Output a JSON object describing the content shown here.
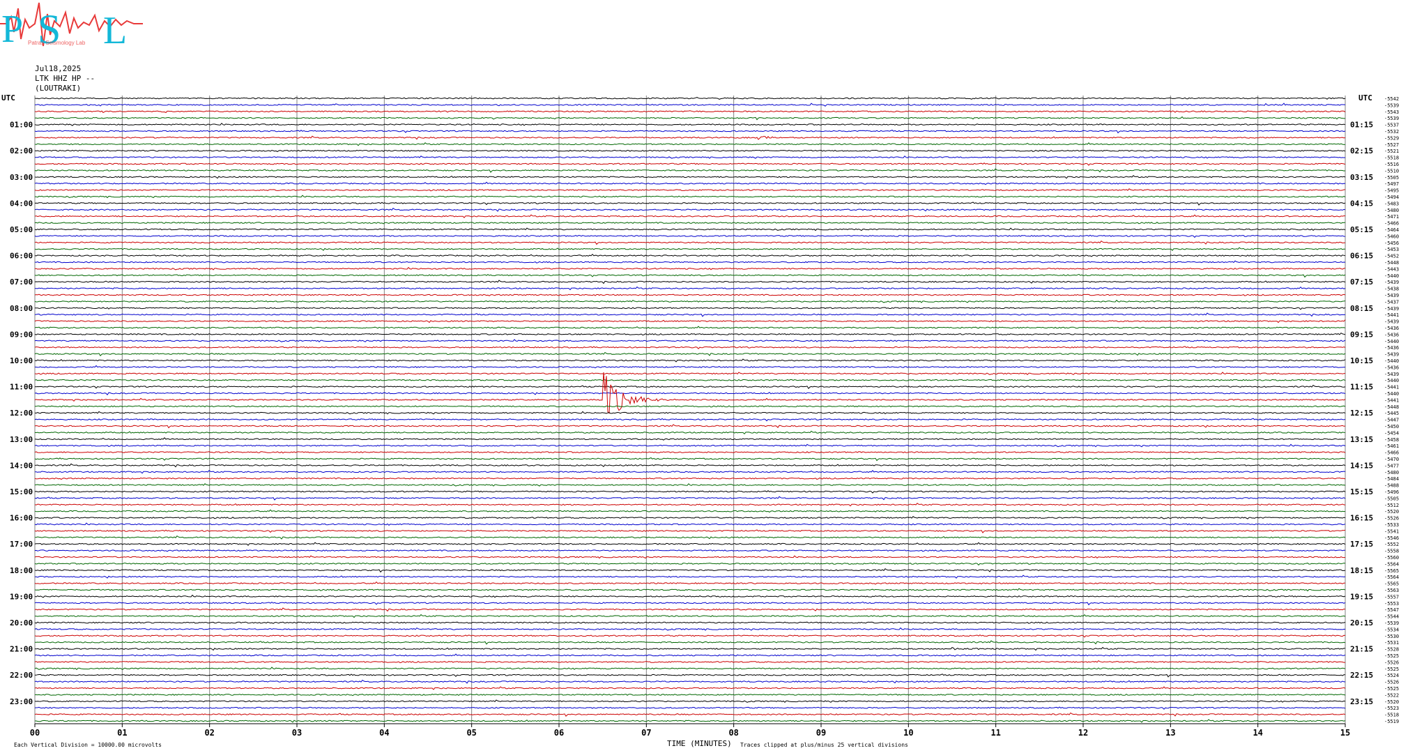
{
  "logo": {
    "letters": [
      "P",
      "S",
      "L"
    ],
    "text": "Patras Seismology Lab"
  },
  "header": {
    "date": "Jul18,2025",
    "channel": "LTK HHZ HP --",
    "station": "(LOUTRAKI)"
  },
  "footer": {
    "note_left": "Each Vertical Division = 10000.00 microvolts",
    "xlabel": "TIME (MINUTES)",
    "note_right": "Traces clipped at plus/minus 25 vertical divisions"
  },
  "colors": {
    "trace_cycle": [
      "#000000",
      "#0000cc",
      "#cc0000",
      "#006600"
    ],
    "grid": "#808080",
    "logo_red": "#e83a3a",
    "logo_cyan": "#13b8d8"
  },
  "chart_data": {
    "type": "line",
    "title": "",
    "xlabel": "TIME (MINUTES)",
    "ylabel": "",
    "x_ticks": [
      "00",
      "01",
      "02",
      "03",
      "04",
      "05",
      "06",
      "07",
      "08",
      "09",
      "10",
      "11",
      "12",
      "13",
      "14",
      "15"
    ],
    "xlim": [
      0,
      15
    ],
    "minutes_per_line": 15,
    "lines_total": 96,
    "left_axis_label": "UTC",
    "right_axis_label": "UTC",
    "left_time_labels": [
      "01:00",
      "02:00",
      "03:00",
      "04:00",
      "05:00",
      "06:00",
      "07:00",
      "08:00",
      "09:00",
      "10:00",
      "11:00",
      "12:00",
      "13:00",
      "14:00",
      "15:00",
      "16:00",
      "17:00",
      "18:00",
      "19:00",
      "20:00",
      "21:00",
      "22:00",
      "23:00"
    ],
    "right_time_labels": [
      "01:15",
      "02:15",
      "03:15",
      "04:15",
      "05:15",
      "06:15",
      "07:15",
      "08:15",
      "09:15",
      "10:15",
      "11:15",
      "12:15",
      "13:15",
      "14:15",
      "15:15",
      "16:15",
      "17:15",
      "18:15",
      "19:15",
      "20:15",
      "21:15",
      "22:15",
      "23:15"
    ],
    "right_offsets": [
      "-5542",
      "-5539",
      "-5543",
      "-5539",
      "-5537",
      "-5532",
      "-5529",
      "-5527",
      "-5521",
      "-5518",
      "-5516",
      "-5510",
      "-5505",
      "-5497",
      "-5495",
      "-5494",
      "-5483",
      "-5480",
      "-5471",
      "-5466",
      "-5464",
      "-5460",
      "-5456",
      "-5453",
      "-5452",
      "-5448",
      "-5443",
      "-5440",
      "-5439",
      "-5438",
      "-5439",
      "-5437",
      "-5439",
      "-5441",
      "-5439",
      "-5436",
      "-5436",
      "-5440",
      "-5436",
      "-5439",
      "-5440",
      "-5436",
      "-5439",
      "-5440",
      "-5441",
      "-5440",
      "-5441",
      "-5448",
      "-5445",
      "-5447",
      "-5450",
      "-5454",
      "-5458",
      "-5461",
      "-5466",
      "-5470",
      "-5477",
      "-5480",
      "-5484",
      "-5488",
      "-5496",
      "-5505",
      "-5512",
      "-5520",
      "-5526",
      "-5533",
      "-5541",
      "-5546",
      "-5552",
      "-5558",
      "-5560",
      "-5564",
      "-5565",
      "-5564",
      "-5565",
      "-5563",
      "-5557",
      "-5553",
      "-5547",
      "-5544",
      "-5539",
      "-5534",
      "-5530",
      "-5531",
      "-5528",
      "-5525",
      "-5526",
      "-5525",
      "-5524",
      "-5526",
      "-5525",
      "-5522",
      "-5520",
      "-5523",
      "-5518",
      "-5519"
    ],
    "events": [
      {
        "line": 46,
        "start_minute": 6.5,
        "duration_minutes": 0.9,
        "amplitude_divisions": 4.5,
        "color": "#000000"
      },
      {
        "line": 6,
        "start_minute": 8.28,
        "duration_minutes": 0.6,
        "amplitude_divisions": 0.3,
        "color": "#0000cc"
      },
      {
        "line": 84,
        "start_minute": 10.5,
        "duration_minutes": 0.6,
        "amplitude_divisions": 0.25,
        "color": "#000000"
      }
    ],
    "grid": true,
    "legend": "none"
  }
}
